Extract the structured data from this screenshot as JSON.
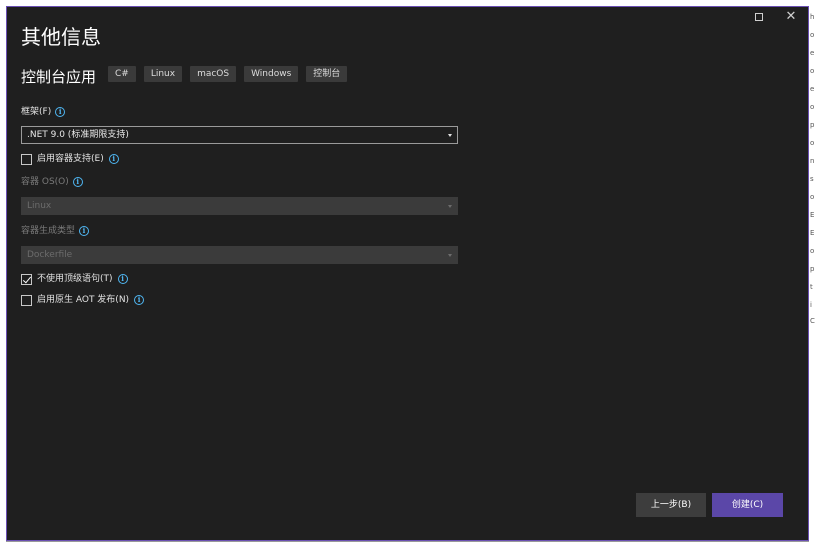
{
  "dialog": {
    "title": "其他信息",
    "subtitle": "控制台应用",
    "tags": [
      "C#",
      "Linux",
      "macOS",
      "Windows",
      "控制台"
    ]
  },
  "titlebar": {
    "maximize_icon": "maximize-icon",
    "close_icon": "close-icon",
    "close_glyph": "✕"
  },
  "framework": {
    "label": "框架(F)",
    "value": ".NET 9.0 (标准期限支持)"
  },
  "enable_container": {
    "label": "启用容器支持(E)",
    "checked": false
  },
  "container_os": {
    "label": "容器 OS(O)",
    "value": "Linux",
    "disabled": true
  },
  "container_build_type": {
    "label": "容器生成类型",
    "value": "Dockerfile",
    "disabled": true
  },
  "no_top_level_statements": {
    "label": "不使用顶级语句(T)",
    "checked": true
  },
  "enable_native_aot": {
    "label": "启用原生 AOT 发布(N)",
    "checked": false
  },
  "buttons": {
    "back": "上一步(B)",
    "create": "创建(C)"
  },
  "colors": {
    "window_bg": "#1f1f1f",
    "accent": "#5b47a8",
    "info_icon": "#4fb6f2"
  }
}
